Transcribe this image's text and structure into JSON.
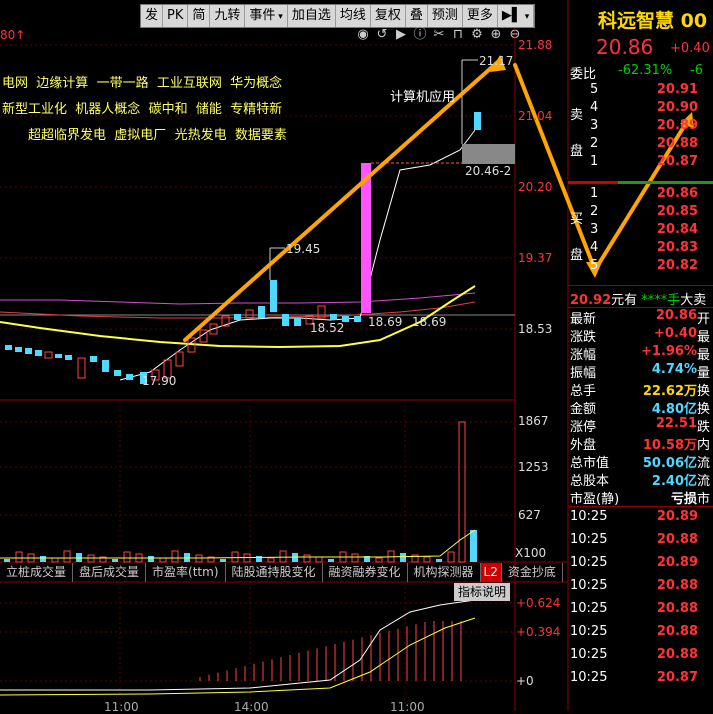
{
  "toolbar": [
    "发",
    "PK",
    "简",
    "九转",
    "事件",
    "加自选",
    "均线",
    "复权",
    "叠",
    "预测",
    "更多",
    "▶▌"
  ],
  "chart_header": {
    "left_label": "80↑"
  },
  "concepts": {
    "line1": [
      "电网",
      "边缘计算",
      "一带一路",
      "工业互联网",
      "华为概念"
    ],
    "line2": [
      "新型工业化",
      "机器人概念",
      "碳中和",
      "储能",
      "专精特新"
    ],
    "line3": [
      "超超临界发电",
      "虚拟电厂",
      "光热发电",
      "数据要素"
    ],
    "tag": "计算机应用"
  },
  "price_axis": [
    "21.88",
    "21.04",
    "20.20",
    "19.37",
    "18.53"
  ],
  "volume_axis": [
    "1867",
    "1253",
    "627",
    "X100"
  ],
  "indicator_axis": [
    "+0.624",
    "+0.394",
    "+0"
  ],
  "annotations": {
    "high": "21.17",
    "low": "17.90",
    "peak_19": "19.45",
    "val_1852": "18.52",
    "range_a": "18.69",
    "range_b": "18.69",
    "box_label": "20.46-2"
  },
  "tabs": [
    "立桩成交量",
    "盘后成交量",
    "市盈率(ttm)",
    "陆股通持股变化",
    "融资融券变化",
    "机构探测器",
    "L2",
    "资金抄底"
  ],
  "indicator_button": "指标说明",
  "time_labels": [
    "11:00",
    "14:00",
    "11:00"
  ],
  "stock": {
    "name": "科远智慧",
    "code": "00",
    "price": "20.86",
    "change": "+0.40"
  },
  "weibi": {
    "label": "委比",
    "value": "-62.31%",
    "extra": "-6"
  },
  "sell_orders": [
    {
      "idx": "5",
      "price": "20.91"
    },
    {
      "idx": "4",
      "price": "20.90"
    },
    {
      "idx": "3",
      "price": "20.89"
    },
    {
      "idx": "2",
      "price": "20.88"
    },
    {
      "idx": "1",
      "price": "20.87"
    }
  ],
  "buy_orders": [
    {
      "idx": "1",
      "price": "20.86"
    },
    {
      "idx": "2",
      "price": "20.85"
    },
    {
      "idx": "3",
      "price": "20.84"
    },
    {
      "idx": "4",
      "price": "20.83"
    },
    {
      "idx": "5",
      "price": "20.82"
    }
  ],
  "side_labels": {
    "sell_a": "卖",
    "sell_b": "盘",
    "buy_a": "买",
    "buy_b": "盘"
  },
  "last_trade": {
    "price": "20.92",
    "unit": "元有",
    "stars": "****手",
    "tail": "大卖"
  },
  "stats": [
    {
      "k": "最新",
      "v": "20.86",
      "t": "开",
      "c": "red"
    },
    {
      "k": "涨跌",
      "v": "+0.40",
      "t": "最",
      "c": "red"
    },
    {
      "k": "涨幅",
      "v": "+1.96%",
      "t": "最",
      "c": "red"
    },
    {
      "k": "振幅",
      "v": "4.74%",
      "t": "量",
      "c": "cyan"
    },
    {
      "k": "总手",
      "v": "22.62万",
      "t": "换",
      "c": "yellow"
    },
    {
      "k": "金额",
      "v": "4.80亿",
      "t": "换",
      "c": "cyan"
    },
    {
      "k": "涨停",
      "v": "22.51",
      "t": "跌",
      "c": "red"
    },
    {
      "k": "外盘",
      "v": "10.58万",
      "t": "内",
      "c": "red"
    },
    {
      "k": "总市值",
      "v": "50.06亿",
      "t": "流",
      "c": "cyan"
    },
    {
      "k": "总股本",
      "v": "2.40亿",
      "t": "流",
      "c": "cyan"
    },
    {
      "k": "市盈(静)",
      "v": "亏损",
      "t": "市",
      "c": "white"
    }
  ],
  "ticks": [
    {
      "t": "10:25",
      "p": "20.89"
    },
    {
      "t": "10:25",
      "p": "20.88"
    },
    {
      "t": "10:25",
      "p": "20.89"
    },
    {
      "t": "10:25",
      "p": "20.88"
    },
    {
      "t": "10:25",
      "p": "20.88"
    },
    {
      "t": "10:25",
      "p": "20.88"
    },
    {
      "t": "10:25",
      "p": "20.88"
    },
    {
      "t": "10:25",
      "p": "20.87"
    }
  ]
}
